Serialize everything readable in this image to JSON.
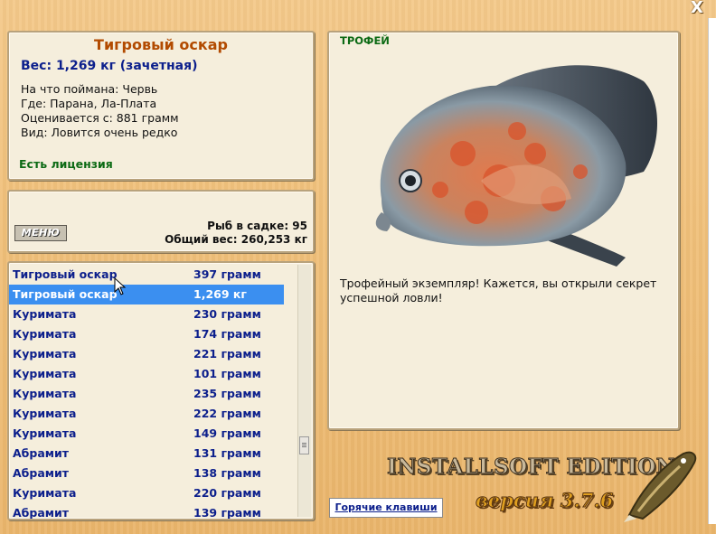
{
  "window": {
    "close_label": "X"
  },
  "info": {
    "title": "Тигровый оскар",
    "weight": "Вес: 1,269 кг (зачетная)",
    "bait": "На что поймана: Червь",
    "location": "Где: Парана, Ла-Плата",
    "scored_from": "Оценивается с: 881 грамм",
    "kind": "Вид: Ловится очень редко",
    "license": "Есть лицензия"
  },
  "stats": {
    "menu_label": "МЕНЮ",
    "fish_in_net": "Рыб в садке: 95",
    "total_weight": "Общий вес: 260,253 кг"
  },
  "catch_list": [
    {
      "name": "Тигровый оскар",
      "weight": "397 грамм"
    },
    {
      "name": "Тигровый оскар",
      "weight": "1,269 кг",
      "selected": true
    },
    {
      "name": "Куримата",
      "weight": "230 грамм"
    },
    {
      "name": "Куримата",
      "weight": "174 грамм"
    },
    {
      "name": "Куримата",
      "weight": "221 грамм"
    },
    {
      "name": "Куримата",
      "weight": "101 грамм"
    },
    {
      "name": "Куримата",
      "weight": "235 грамм"
    },
    {
      "name": "Куримата",
      "weight": "222 грамм"
    },
    {
      "name": "Куримата",
      "weight": "149 грамм"
    },
    {
      "name": "Абрамит",
      "weight": "131 грамм"
    },
    {
      "name": "Абрамит",
      "weight": "138 грамм"
    },
    {
      "name": "Куримата",
      "weight": "220 грамм"
    },
    {
      "name": "Абрамит",
      "weight": "139 грамм"
    }
  ],
  "trophy": {
    "label": "ТРОФЕЙ",
    "text": "Трофейный экземпляр! Кажется, вы открыли секрет успешной ловли!"
  },
  "footer": {
    "hotkeys_label": "Горячие клавиши",
    "brand": "INSTALLSOFT EDITION",
    "version": "версия 3.7.6"
  },
  "colors": {
    "selected_row": "#3b8ff0",
    "list_text": "#0c1f8c",
    "title": "#b24a00",
    "license": "#0c6a14"
  }
}
